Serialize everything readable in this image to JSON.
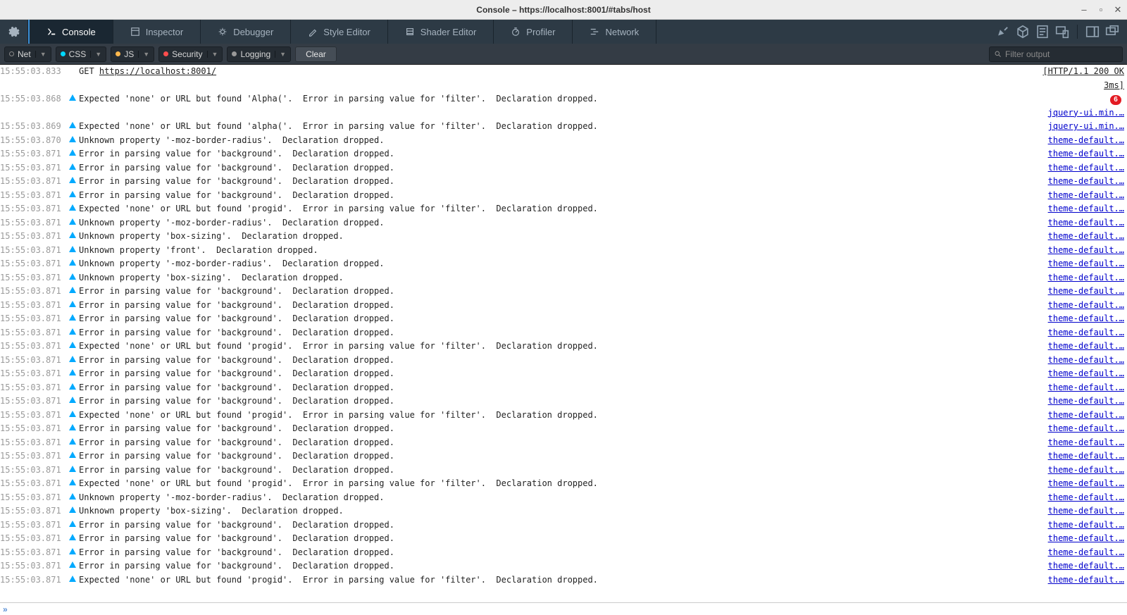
{
  "window": {
    "title": "Console – https://localhost:8001/#tabs/host"
  },
  "tabs": {
    "console": "Console",
    "inspector": "Inspector",
    "debugger": "Debugger",
    "style_editor": "Style Editor",
    "shader_editor": "Shader Editor",
    "profiler": "Profiler",
    "network": "Network"
  },
  "filters": {
    "net": "Net",
    "css": "CSS",
    "js": "JS",
    "security": "Security",
    "logging": "Logging",
    "clear": "Clear",
    "search_placeholder": "Filter output"
  },
  "net_request": {
    "time": "15:55:03.833",
    "method": "GET",
    "url": "https://localhost:8001/",
    "status_line": "[HTTP/1.1 200 OK 3ms]"
  },
  "logs": [
    {
      "time": "15:55:03.868",
      "msg": "Expected 'none' or URL but found 'Alpha('.  Error in parsing value for 'filter'.  Declaration dropped.",
      "src": "jquery-ui.min.…",
      "badge": 6
    },
    {
      "time": "15:55:03.869",
      "msg": "Expected 'none' or URL but found 'alpha('.  Error in parsing value for 'filter'.  Declaration dropped.",
      "src": "jquery-ui.min.…"
    },
    {
      "time": "15:55:03.870",
      "msg": "Unknown property '-moz-border-radius'.  Declaration dropped.",
      "src": "theme-default.…"
    },
    {
      "time": "15:55:03.871",
      "msg": "Error in parsing value for 'background'.  Declaration dropped.",
      "src": "theme-default.…"
    },
    {
      "time": "15:55:03.871",
      "msg": "Error in parsing value for 'background'.  Declaration dropped.",
      "src": "theme-default.…"
    },
    {
      "time": "15:55:03.871",
      "msg": "Error in parsing value for 'background'.  Declaration dropped.",
      "src": "theme-default.…"
    },
    {
      "time": "15:55:03.871",
      "msg": "Error in parsing value for 'background'.  Declaration dropped.",
      "src": "theme-default.…"
    },
    {
      "time": "15:55:03.871",
      "msg": "Expected 'none' or URL but found 'progid'.  Error in parsing value for 'filter'.  Declaration dropped.",
      "src": "theme-default.…"
    },
    {
      "time": "15:55:03.871",
      "msg": "Unknown property '-moz-border-radius'.  Declaration dropped.",
      "src": "theme-default.…"
    },
    {
      "time": "15:55:03.871",
      "msg": "Unknown property 'box-sizing'.  Declaration dropped.",
      "src": "theme-default.…"
    },
    {
      "time": "15:55:03.871",
      "msg": "Unknown property 'front'.  Declaration dropped.",
      "src": "theme-default.…"
    },
    {
      "time": "15:55:03.871",
      "msg": "Unknown property '-moz-border-radius'.  Declaration dropped.",
      "src": "theme-default.…"
    },
    {
      "time": "15:55:03.871",
      "msg": "Unknown property 'box-sizing'.  Declaration dropped.",
      "src": "theme-default.…"
    },
    {
      "time": "15:55:03.871",
      "msg": "Error in parsing value for 'background'.  Declaration dropped.",
      "src": "theme-default.…"
    },
    {
      "time": "15:55:03.871",
      "msg": "Error in parsing value for 'background'.  Declaration dropped.",
      "src": "theme-default.…"
    },
    {
      "time": "15:55:03.871",
      "msg": "Error in parsing value for 'background'.  Declaration dropped.",
      "src": "theme-default.…"
    },
    {
      "time": "15:55:03.871",
      "msg": "Error in parsing value for 'background'.  Declaration dropped.",
      "src": "theme-default.…"
    },
    {
      "time": "15:55:03.871",
      "msg": "Expected 'none' or URL but found 'progid'.  Error in parsing value for 'filter'.  Declaration dropped.",
      "src": "theme-default.…"
    },
    {
      "time": "15:55:03.871",
      "msg": "Error in parsing value for 'background'.  Declaration dropped.",
      "src": "theme-default.…"
    },
    {
      "time": "15:55:03.871",
      "msg": "Error in parsing value for 'background'.  Declaration dropped.",
      "src": "theme-default.…"
    },
    {
      "time": "15:55:03.871",
      "msg": "Error in parsing value for 'background'.  Declaration dropped.",
      "src": "theme-default.…"
    },
    {
      "time": "15:55:03.871",
      "msg": "Error in parsing value for 'background'.  Declaration dropped.",
      "src": "theme-default.…"
    },
    {
      "time": "15:55:03.871",
      "msg": "Expected 'none' or URL but found 'progid'.  Error in parsing value for 'filter'.  Declaration dropped.",
      "src": "theme-default.…"
    },
    {
      "time": "15:55:03.871",
      "msg": "Error in parsing value for 'background'.  Declaration dropped.",
      "src": "theme-default.…"
    },
    {
      "time": "15:55:03.871",
      "msg": "Error in parsing value for 'background'.  Declaration dropped.",
      "src": "theme-default.…"
    },
    {
      "time": "15:55:03.871",
      "msg": "Error in parsing value for 'background'.  Declaration dropped.",
      "src": "theme-default.…"
    },
    {
      "time": "15:55:03.871",
      "msg": "Error in parsing value for 'background'.  Declaration dropped.",
      "src": "theme-default.…"
    },
    {
      "time": "15:55:03.871",
      "msg": "Expected 'none' or URL but found 'progid'.  Error in parsing value for 'filter'.  Declaration dropped.",
      "src": "theme-default.…"
    },
    {
      "time": "15:55:03.871",
      "msg": "Unknown property '-moz-border-radius'.  Declaration dropped.",
      "src": "theme-default.…"
    },
    {
      "time": "15:55:03.871",
      "msg": "Unknown property 'box-sizing'.  Declaration dropped.",
      "src": "theme-default.…"
    },
    {
      "time": "15:55:03.871",
      "msg": "Error in parsing value for 'background'.  Declaration dropped.",
      "src": "theme-default.…"
    },
    {
      "time": "15:55:03.871",
      "msg": "Error in parsing value for 'background'.  Declaration dropped.",
      "src": "theme-default.…"
    },
    {
      "time": "15:55:03.871",
      "msg": "Error in parsing value for 'background'.  Declaration dropped.",
      "src": "theme-default.…"
    },
    {
      "time": "15:55:03.871",
      "msg": "Error in parsing value for 'background'.  Declaration dropped.",
      "src": "theme-default.…"
    },
    {
      "time": "15:55:03.871",
      "msg": "Expected 'none' or URL but found 'progid'.  Error in parsing value for 'filter'.  Declaration dropped.",
      "src": "theme-default.…"
    }
  ]
}
